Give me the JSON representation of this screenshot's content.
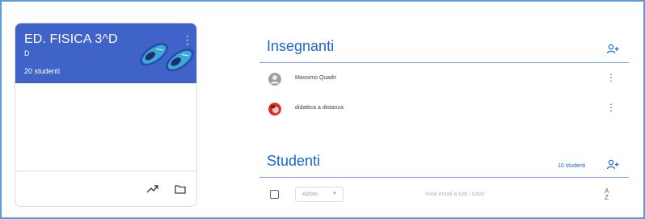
{
  "class_card": {
    "title": "ED. FISICA 3^D",
    "section": "D",
    "student_count": "20 studenti",
    "header_color": "#3f63c9",
    "footer_icons": [
      "trending-up-icon",
      "folder-icon"
    ]
  },
  "teachers": {
    "title": "Insegnanti",
    "add_icon": "add-person-icon",
    "items": [
      {
        "name": "Massimo Quadri",
        "avatar": "default-avatar-icon"
      },
      {
        "name": "didattica a distanza",
        "avatar": "photo-avatar"
      }
    ]
  },
  "students": {
    "title": "Studenti",
    "count_label": "10 studenti",
    "add_icon": "add-person-icon",
    "actions_label": "Azioni",
    "email_tutors_label": "Invia email a tutti i tutori",
    "sort_icon": "sort-az-icon"
  },
  "colors": {
    "accent": "#1967d2",
    "divider": "#7aa4e8"
  }
}
